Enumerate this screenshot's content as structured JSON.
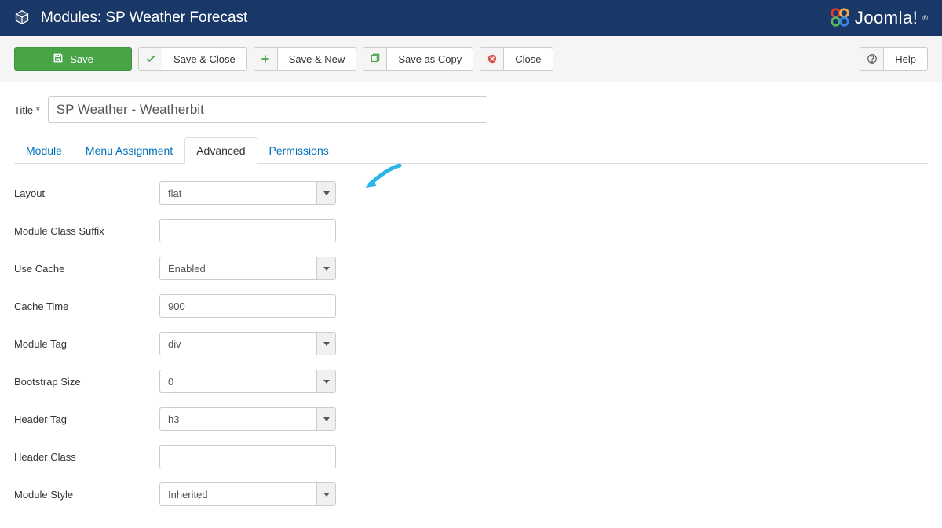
{
  "header": {
    "title": "Modules: SP Weather Forecast",
    "brand": "Joomla!"
  },
  "toolbar": {
    "save": "Save",
    "save_close": "Save & Close",
    "save_new": "Save & New",
    "save_copy": "Save as Copy",
    "close": "Close",
    "help": "Help"
  },
  "title_field": {
    "label": "Title *",
    "value": "SP Weather - Weatherbit"
  },
  "tabs": [
    {
      "label": "Module"
    },
    {
      "label": "Menu Assignment"
    },
    {
      "label": "Advanced"
    },
    {
      "label": "Permissions"
    }
  ],
  "active_tab": "Advanced",
  "fields": {
    "layout": {
      "label": "Layout",
      "value": "flat",
      "type": "select"
    },
    "module_class_suffix": {
      "label": "Module Class Suffix",
      "value": "",
      "type": "text"
    },
    "use_cache": {
      "label": "Use Cache",
      "value": "Enabled",
      "type": "select"
    },
    "cache_time": {
      "label": "Cache Time",
      "value": "900",
      "type": "text"
    },
    "module_tag": {
      "label": "Module Tag",
      "value": "div",
      "type": "select"
    },
    "bootstrap_size": {
      "label": "Bootstrap Size",
      "value": "0",
      "type": "select"
    },
    "header_tag": {
      "label": "Header Tag",
      "value": "h3",
      "type": "select"
    },
    "header_class": {
      "label": "Header Class",
      "value": "",
      "type": "text"
    },
    "module_style": {
      "label": "Module Style",
      "value": "Inherited",
      "type": "select"
    }
  }
}
